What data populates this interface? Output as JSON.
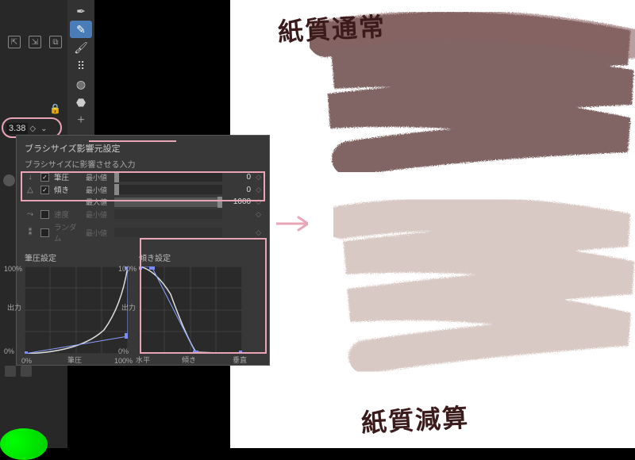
{
  "sidebar": {
    "size_value": "3.38",
    "icons": [
      "export-icon",
      "import-icon",
      "copy-icon"
    ]
  },
  "toolbar": {
    "tools": [
      {
        "name": "eyedropper-icon",
        "active": false
      },
      {
        "name": "pen-icon",
        "active": true
      },
      {
        "name": "brush-icon",
        "active": false
      },
      {
        "name": "spray-icon",
        "active": false
      },
      {
        "name": "fill-icon",
        "active": false
      },
      {
        "name": "blend-icon",
        "active": false
      },
      {
        "name": "add-icon",
        "active": false
      }
    ]
  },
  "panel": {
    "title": "ブラシサイズ影響元設定",
    "subtitle": "ブラシサイズに影響させる入力",
    "rows": {
      "pressure": {
        "label": "筆圧",
        "sublabel": "最小値",
        "value": "0",
        "checked": true,
        "enabled": true,
        "fill": 0
      },
      "tilt_min": {
        "label": "傾き",
        "sublabel": "最小値",
        "value": "0",
        "checked": true,
        "enabled": true,
        "fill": 0
      },
      "tilt_max": {
        "label": "",
        "sublabel": "最大値",
        "value": "1000",
        "checked": null,
        "enabled": true,
        "fill": 100
      },
      "speed": {
        "label": "速度",
        "sublabel": "最小値",
        "value": "",
        "checked": false,
        "enabled": false,
        "fill": 0
      },
      "random": {
        "label": "ランダム",
        "sublabel": "最小値",
        "value": "",
        "checked": false,
        "enabled": false,
        "fill": 0
      }
    },
    "graphs": {
      "pressure": {
        "title": "筆圧設定",
        "ylabel": "出力",
        "y100": "100%",
        "y0": "0%",
        "x0": "0%",
        "xmid": "筆圧",
        "x100": "100%"
      },
      "tilt": {
        "title": "傾き設定",
        "ylabel": "出力",
        "y100": "100%",
        "y0": "0%",
        "x0": "水平",
        "xmid": "傾き",
        "x100": "垂直"
      }
    }
  },
  "canvas": {
    "label_top": "紙質通常",
    "label_bottom": "紙質減算"
  },
  "colors": {
    "accent": "#e9a5b6",
    "stroke_dark": "#7a5050",
    "stroke_light": "#c8b0a8"
  },
  "chart_data": [
    {
      "type": "line",
      "title": "筆圧設定",
      "xlabel": "筆圧",
      "ylabel": "出力",
      "xlim": [
        0,
        100
      ],
      "ylim": [
        0,
        100
      ],
      "series": [
        {
          "name": "curve",
          "x": [
            0,
            50,
            80,
            95,
            100
          ],
          "y": [
            0,
            5,
            20,
            60,
            100
          ]
        },
        {
          "name": "control-points",
          "x": [
            0,
            100,
            100
          ],
          "y": [
            0,
            20,
            100
          ]
        }
      ]
    },
    {
      "type": "line",
      "title": "傾き設定",
      "xlabel": "傾き",
      "ylabel": "出力",
      "xlim": [
        0,
        100
      ],
      "ylim": [
        0,
        100
      ],
      "series": [
        {
          "name": "curve",
          "x": [
            0,
            12,
            30,
            50,
            55,
            100
          ],
          "y": [
            100,
            98,
            70,
            15,
            2,
            0
          ]
        },
        {
          "name": "control-points",
          "x": [
            0,
            12,
            55,
            100
          ],
          "y": [
            100,
            100,
            0,
            0
          ]
        }
      ]
    }
  ]
}
